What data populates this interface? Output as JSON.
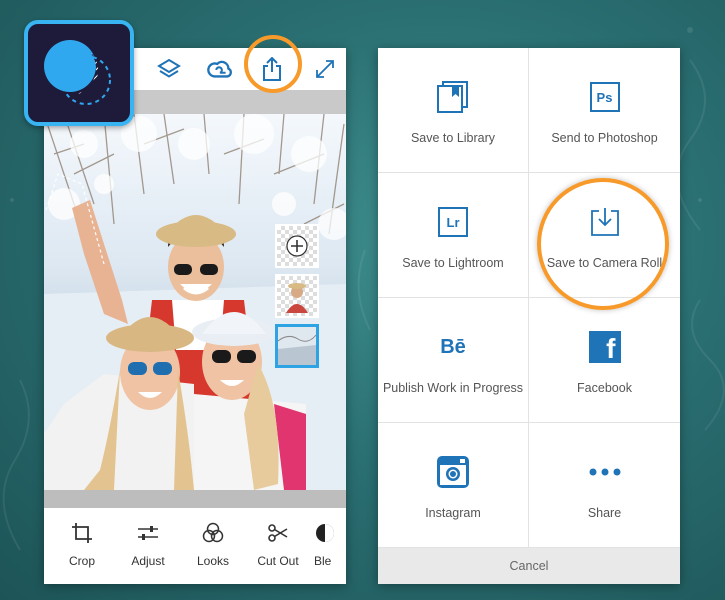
{
  "editor": {
    "top_icons": [
      "layers-icon",
      "creative-cloud-icon",
      "share-icon",
      "expand-icon"
    ],
    "tools": [
      {
        "label": "Crop",
        "icon": "crop-icon"
      },
      {
        "label": "Adjust",
        "icon": "adjust-icon"
      },
      {
        "label": "Looks",
        "icon": "looks-icon"
      },
      {
        "label": "Cut Out",
        "icon": "cut-out-icon"
      },
      {
        "label": "Ble",
        "icon": "blend-icon"
      }
    ],
    "layers": [
      "add-layer",
      "photo-layer",
      "winter-layer"
    ]
  },
  "share_menu": {
    "items": [
      {
        "label": "Save to Library",
        "icon": "library-icon"
      },
      {
        "label": "Send to Photoshop",
        "icon": "photoshop-icon",
        "badge": "Ps"
      },
      {
        "label": "Save to Lightroom",
        "icon": "lightroom-icon",
        "badge": "Lr"
      },
      {
        "label": "Save to Camera Roll",
        "icon": "camera-roll-icon"
      },
      {
        "label": "Publish Work in Progress",
        "icon": "behance-icon",
        "badge": "Bē"
      },
      {
        "label": "Facebook",
        "icon": "facebook-icon",
        "badge": "f"
      },
      {
        "label": "Instagram",
        "icon": "instagram-icon"
      },
      {
        "label": "Share",
        "icon": "more-icon"
      }
    ],
    "cancel_label": "Cancel"
  },
  "colors": {
    "accent_blue": "#1f73b7",
    "highlight_orange": "#f79a2a",
    "app_icon_border": "#38b4f2"
  }
}
